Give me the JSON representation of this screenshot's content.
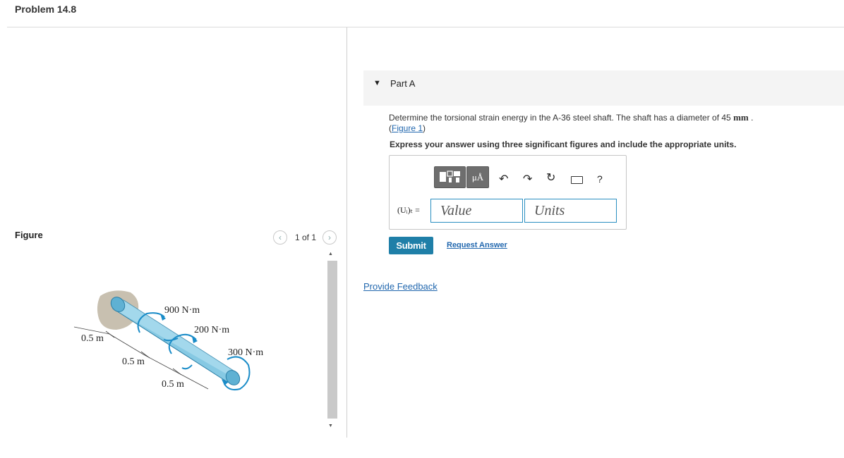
{
  "problem": {
    "title": "Problem 14.8"
  },
  "figure_panel": {
    "label": "Figure",
    "pager": "1 of 1",
    "labels": {
      "torque_1": "900 N·m",
      "torque_2": "200 N·m",
      "torque_3": "300 N·m",
      "dim_1": "0.5 m",
      "dim_2": "0.5 m",
      "dim_3": "0.5 m"
    }
  },
  "part": {
    "title": "Part A",
    "question_before": "Determine the torsional strain energy in the A-36 steel shaft. The shaft has a diameter of 45 ",
    "question_unit": "mm",
    "question_after": " .",
    "figure_link": "Figure 1",
    "instruction": "Express your answer using three significant figures and include the appropriate units.",
    "variable_label": "(Uᵢ)ₜ =",
    "value_placeholder": "Value",
    "units_placeholder": "Units",
    "units_tool": "μÅ",
    "help": "?",
    "submit": "Submit",
    "request_answer": "Request Answer"
  },
  "feedback": {
    "label": "Provide Feedback"
  },
  "colors": {
    "accent": "#1f7fa8",
    "link": "#2167ae",
    "input_border": "#2a8fc1",
    "shaft": "#7cc4e0"
  }
}
